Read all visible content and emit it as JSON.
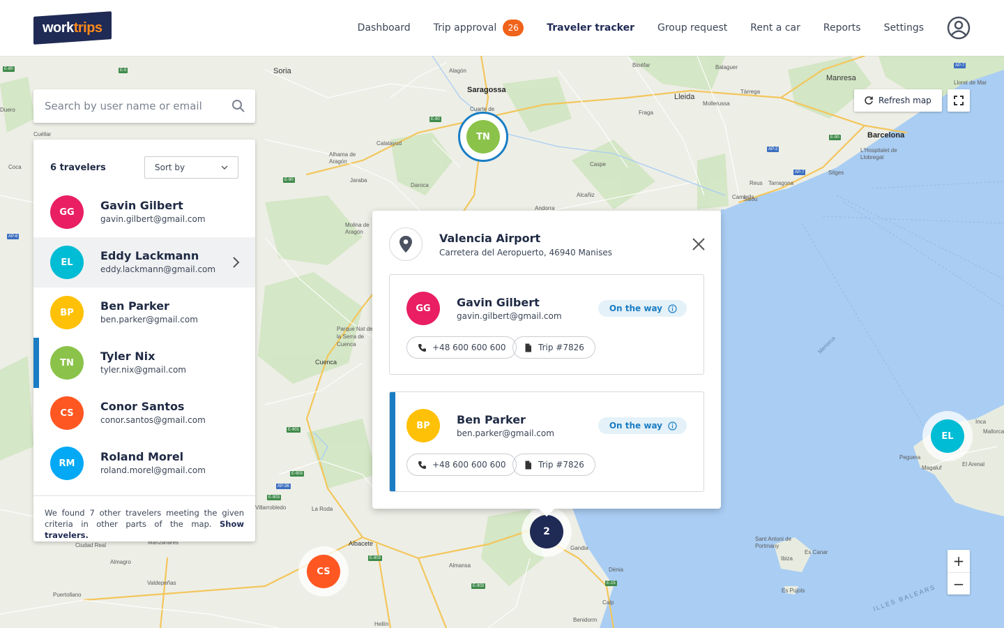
{
  "brand": {
    "logo_main": "work",
    "logo_accent": "trips"
  },
  "nav": {
    "items": [
      {
        "label": "Dashboard"
      },
      {
        "label": "Trip approval",
        "badge": "26"
      },
      {
        "label": "Traveler tracker",
        "active": true
      },
      {
        "label": "Group request"
      },
      {
        "label": "Rent a car"
      },
      {
        "label": "Reports"
      },
      {
        "label": "Settings"
      }
    ],
    "account_icon": "user-circle-icon"
  },
  "search": {
    "placeholder": "Search by user name or email",
    "value": "",
    "icon": "search-icon"
  },
  "travelers_panel": {
    "count_label": "6 travelers",
    "sort_label": "Sort by",
    "travelers": [
      {
        "initials": "GG",
        "name": "Gavin Gilbert",
        "email": "gavin.gilbert@gmail.com",
        "color": "#e91e63"
      },
      {
        "initials": "EL",
        "name": "Eddy Lackmann",
        "email": "eddy.lackmann@gmail.com",
        "color": "#00bcd4"
      },
      {
        "initials": "BP",
        "name": "Ben Parker",
        "email": "ben.parker@gmail.com",
        "color": "#ffc107"
      },
      {
        "initials": "TN",
        "name": "Tyler Nix",
        "email": "tyler.nix@gmail.com",
        "color": "#8bc34a"
      },
      {
        "initials": "CS",
        "name": "Conor Santos",
        "email": "conor.santos@gmail.com",
        "color": "#ff5722"
      },
      {
        "initials": "RM",
        "name": "Roland Morel",
        "email": "roland.morel@gmail.com",
        "color": "#03a9f4"
      }
    ],
    "footer_text": "We found 7 other travelers meeting the given criteria in other parts of the map. ",
    "footer_link": "Show travelers."
  },
  "map_controls": {
    "refresh_label": "Refresh map",
    "zoom_in": "+",
    "zoom_out": "−"
  },
  "map_markers": [
    {
      "label": "TN",
      "color": "#8bc34a",
      "selected": true
    },
    {
      "label": "EL",
      "color": "#00bcd4"
    },
    {
      "label": "CS",
      "color": "#ff5722"
    },
    {
      "label": "2",
      "color": "#1f2a55"
    }
  ],
  "map_labels": {
    "cities": [
      "Soria",
      "Saragossa",
      "Lleida",
      "Tàrrega",
      "Manresa",
      "Lloret de Mar",
      "Barcelona",
      "L'Hospitalet de Llobregat",
      "Sitges",
      "Reus",
      "Tarragona",
      "Cambrils",
      "Salou",
      "Caspe",
      "Alcañiz",
      "Calatayud",
      "Alhama de Aragón",
      "Jaraba",
      "Daroca",
      "Molina de Aragón",
      "Andorra",
      "Cuenca",
      "Parque Nat de la Serra de Cuenca",
      "Alagón",
      "Cuarte de",
      "Fraga",
      "Binéfar",
      "Balaguer",
      "Mollerussa",
      "La Roda",
      "Albacete",
      "Almansa",
      "Gandia",
      "Dénia",
      "Calp",
      "Benidorm",
      "Hellín",
      "Ciudad Real",
      "Manzanares",
      "Almagro",
      "Valdepeñas",
      "Puertollano",
      "Villarrobledo",
      "Sant Antoni de Portmany",
      "Es Canar",
      "Ibiza",
      "Es Pujols",
      "Peguera",
      "Magaluf",
      "Inca",
      "Mallorca",
      "El Arenal",
      "Cuéllar",
      "Coca",
      "Duero"
    ],
    "sea": [
      "ILLES BALEARS",
      "Menorca"
    ]
  },
  "popup": {
    "title": "Valencia Airport",
    "address": "Carretera del Aeropuerto, 46940 Manises",
    "cards": [
      {
        "initials": "GG",
        "name": "Gavin Gilbert",
        "email": "gavin.gilbert@gmail.com",
        "color": "#e91e63",
        "status": "On the way",
        "phone": "+48 600 600 600",
        "trip": "Trip #7826"
      },
      {
        "initials": "BP",
        "name": "Ben Parker",
        "email": "ben.parker@gmail.com",
        "color": "#ffc107",
        "status": "On the way",
        "phone": "+48 600 600 600",
        "trip": "Trip #7826"
      }
    ]
  },
  "colors": {
    "brand_navy": "#1f2a55",
    "accent_blue": "#1a7dc4",
    "badge_orange": "#f0631a",
    "sea": "#a9cdf3",
    "land": "#edeee6"
  }
}
